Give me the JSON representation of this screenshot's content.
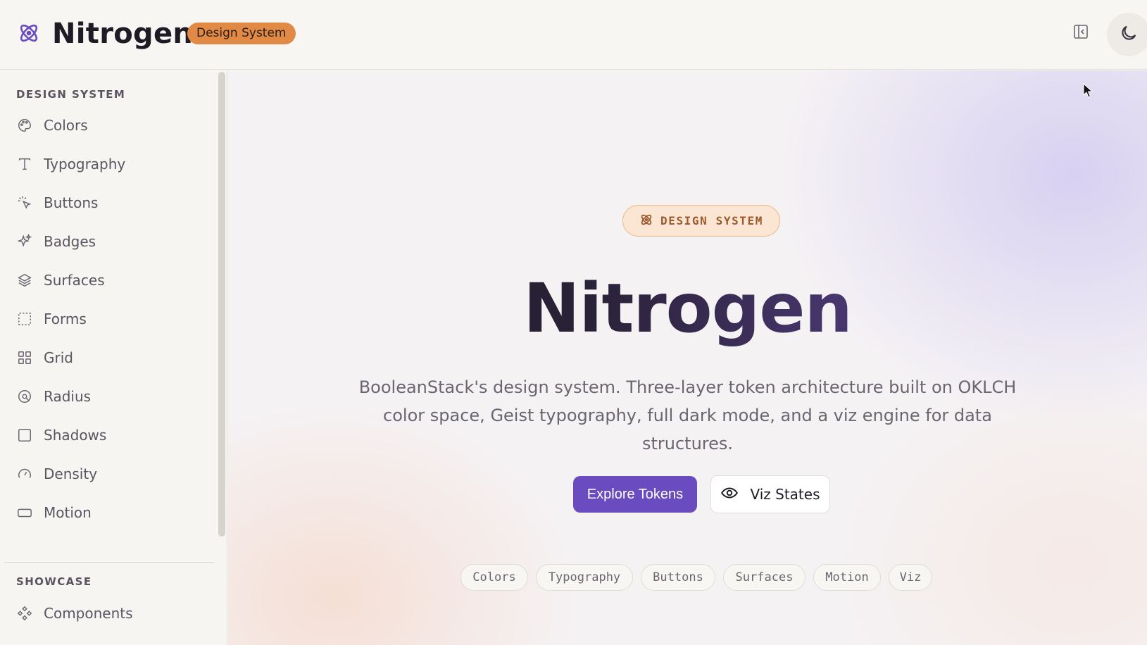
{
  "header": {
    "brand": "Nitrogen",
    "badge": "Design System",
    "icons": {
      "logo": "atom-icon",
      "sidebar_toggle": "panel-left-icon",
      "theme": "moon-icon"
    }
  },
  "sidebar": {
    "sections": [
      {
        "title": "DESIGN SYSTEM",
        "items": [
          {
            "label": "Colors",
            "icon": "palette-icon"
          },
          {
            "label": "Typography",
            "icon": "type-icon"
          },
          {
            "label": "Buttons",
            "icon": "pointer-click-icon"
          },
          {
            "label": "Badges",
            "icon": "sparkles-icon"
          },
          {
            "label": "Surfaces",
            "icon": "layers-icon"
          },
          {
            "label": "Forms",
            "icon": "dashed-square-icon"
          },
          {
            "label": "Grid",
            "icon": "grid-icon"
          },
          {
            "label": "Radius",
            "icon": "radius-icon"
          },
          {
            "label": "Shadows",
            "icon": "square-icon"
          },
          {
            "label": "Density",
            "icon": "gauge-icon"
          },
          {
            "label": "Motion",
            "icon": "rectangle-icon"
          }
        ]
      },
      {
        "title": "SHOWCASE",
        "items": [
          {
            "label": "Components",
            "icon": "components-icon"
          }
        ]
      }
    ]
  },
  "hero": {
    "badge": "DESIGN SYSTEM",
    "title": "Nitrogen",
    "description": "BooleanStack's design system. Three-layer token architecture built on OKLCH color space, Geist typography, full dark mode, and a viz engine for data structures.",
    "primary_button": "Explore Tokens",
    "secondary_button": "Viz States",
    "chips": [
      "Colors",
      "Typography",
      "Buttons",
      "Surfaces",
      "Motion",
      "Viz"
    ]
  },
  "colors": {
    "accent": "#6a4cc0",
    "brand_badge": "#e08a45",
    "pill_border": "#ecb98b"
  }
}
